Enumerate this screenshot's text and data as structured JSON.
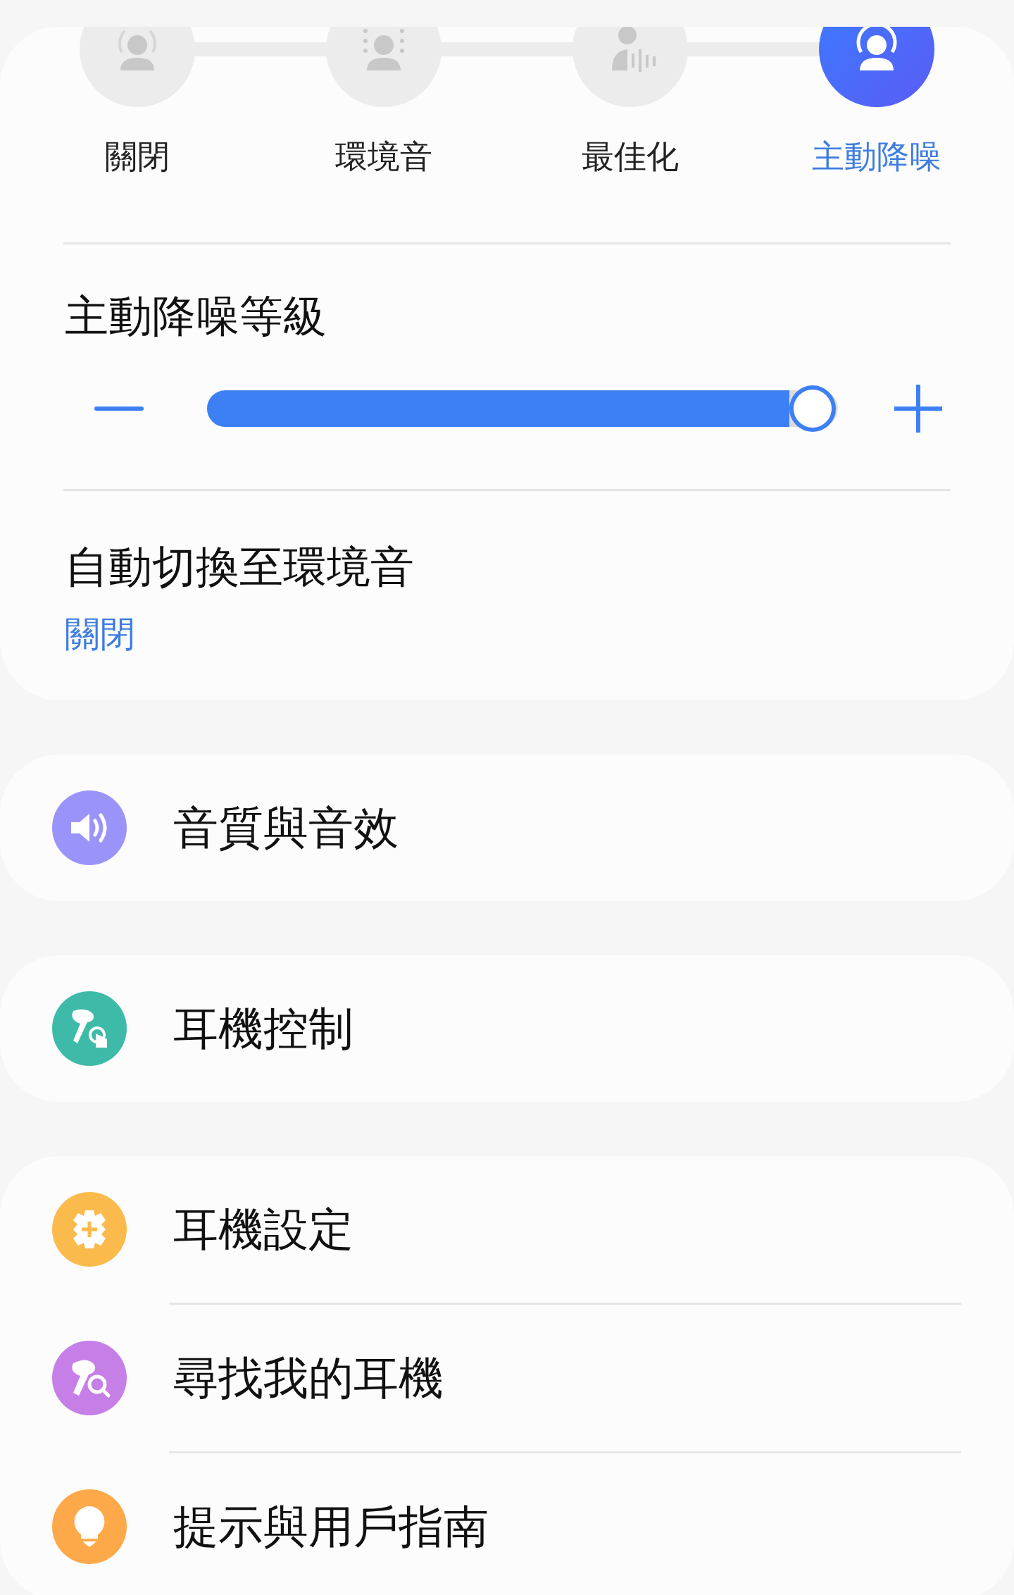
{
  "modes": [
    {
      "label": "關閉",
      "kind": "off",
      "selected": false
    },
    {
      "label": "環境音",
      "kind": "ambient",
      "selected": false
    },
    {
      "label": "最佳化",
      "kind": "adaptive",
      "selected": false
    },
    {
      "label": "主動降噪",
      "kind": "anc",
      "selected": true
    }
  ],
  "anc_level": {
    "title": "主動降噪等級",
    "level": 0.96
  },
  "auto_switch": {
    "title": "自動切換至環境音",
    "value": "關閉"
  },
  "menu_groups": [
    [
      {
        "label": "音質與音效",
        "kind": "sound",
        "color": "#9a94fa"
      }
    ],
    [
      {
        "label": "耳機控制",
        "kind": "controls",
        "color": "#3dbaa8"
      }
    ],
    [
      {
        "label": "耳機設定",
        "kind": "settings",
        "color": "#fbbb4c"
      },
      {
        "label": "尋找我的耳機",
        "kind": "find",
        "color": "#c77fe8"
      },
      {
        "label": "提示與用戶指南",
        "kind": "tips",
        "color": "#fda94a"
      }
    ]
  ]
}
